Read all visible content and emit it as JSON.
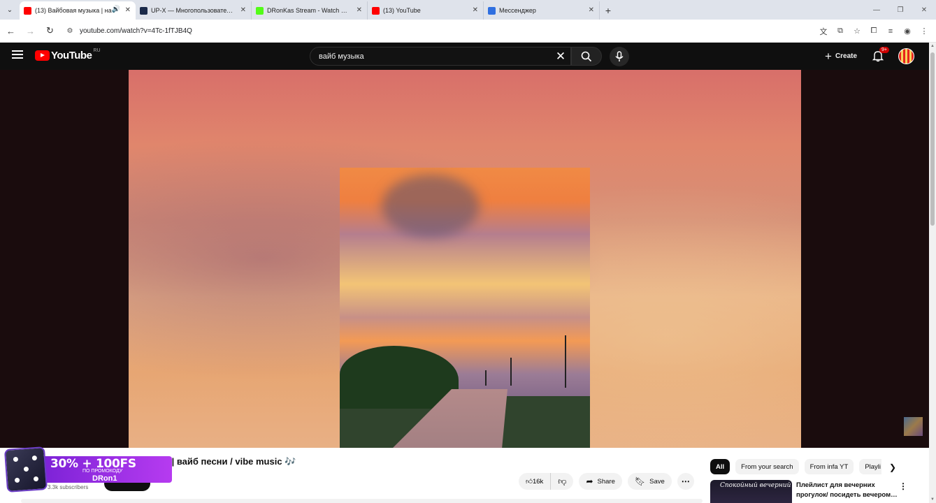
{
  "browser": {
    "tabs": [
      {
        "label": "(13) Вайбовая музыка | на",
        "favicon_color": "#ff0000",
        "active": true,
        "audio": true
      },
      {
        "label": "UP-X — Многопользовательс",
        "favicon_color": "#1b2a4a",
        "active": false
      },
      {
        "label": "DRonKas Stream - Watch Live o",
        "favicon_color": "#53fc18",
        "active": false
      },
      {
        "label": "(13) YouTube",
        "favicon_color": "#ff0000",
        "active": false
      },
      {
        "label": "Мессенджер",
        "favicon_color": "#2f6fe0",
        "active": false
      }
    ],
    "url": "youtube.com/watch?v=4Tc-1fTJB4Q"
  },
  "youtube": {
    "logo_text": "YouTube",
    "country_code": "RU",
    "search_query": "вайб музыка",
    "create_label": "Create",
    "notification_badge": "9+"
  },
  "video": {
    "title_visible": "й | вайб песни / vibe music 🎶",
    "subscribers": "3.3k subscribers",
    "likes": "16k",
    "share_label": "Share",
    "save_label": "Save"
  },
  "ad": {
    "headline": "30% + 100FS",
    "subline": "ПО ПРОМОКОДУ",
    "code": "DRon1"
  },
  "sidebar": {
    "chips": [
      {
        "label": "All",
        "selected": true
      },
      {
        "label": "From your search",
        "selected": false
      },
      {
        "label": "From infa YT",
        "selected": false
      },
      {
        "label": "Playli",
        "selected": false
      }
    ],
    "recommendation": {
      "thumb_text": "Спокойный вечерний",
      "title": "Плейлист для вечерних прогулок/ посидеть вечером…"
    }
  },
  "colors": {
    "yt_red": "#ff0000",
    "header_bg": "#0f0f0f",
    "ad_purple": "#b63bf0"
  }
}
